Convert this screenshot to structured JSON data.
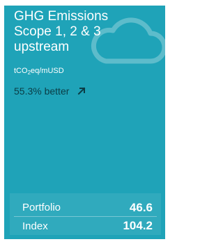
{
  "card": {
    "title_lines": [
      "GHG Emissions",
      "Scope 1, 2 & 3",
      "upstream"
    ],
    "unit_main": "tCO",
    "unit_sub": "2",
    "unit_rest": "eq/mUSD",
    "performance": "55.3% better",
    "icons": {
      "background": "cloud-icon",
      "trend": "arrow-up-right-icon"
    },
    "colors": {
      "background": "#1fa3b8",
      "performance_text": "#0b3c45"
    },
    "stats": [
      {
        "label": "Portfolio",
        "value": "46.6"
      },
      {
        "label": "Index",
        "value": "104.2"
      }
    ]
  }
}
